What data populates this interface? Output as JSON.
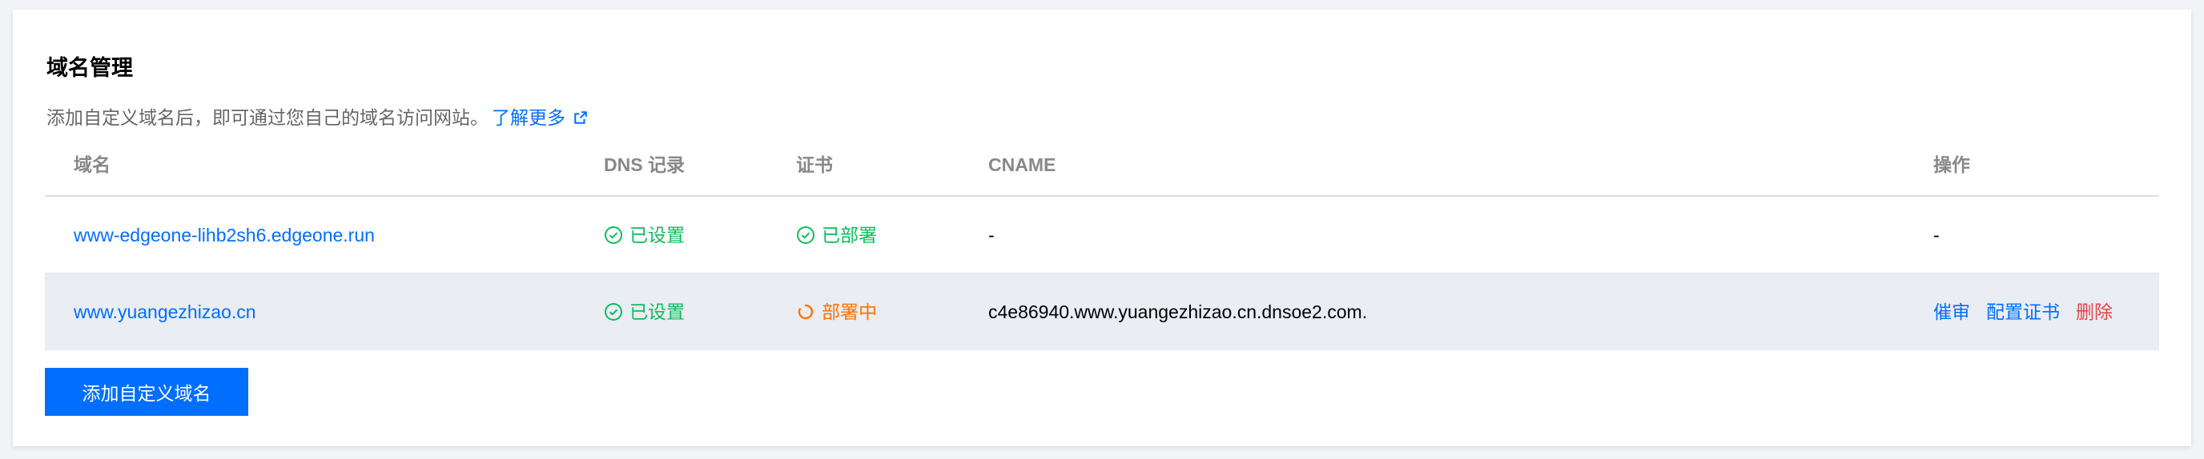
{
  "section": {
    "title": "域名管理",
    "description": "添加自定义域名后，即可通过您自己的域名访问网站。",
    "learn_more": "了解更多"
  },
  "table": {
    "columns": [
      "域名",
      "DNS 记录",
      "证书",
      "CNAME",
      "操作"
    ],
    "rows": [
      {
        "domain": "www-edgeone-lihb2sh6.edgeone.run",
        "dns": "已设置",
        "dns_status": "ok",
        "cert": "已部署",
        "cert_status": "ok",
        "cname": "-",
        "ops_text": "-"
      },
      {
        "domain": "www.yuangezhizao.cn",
        "dns": "已设置",
        "dns_status": "ok",
        "cert": "部署中",
        "cert_status": "pending",
        "cname": "c4e86940.www.yuangezhizao.cn.dnsoe2.com.",
        "ops": [
          "催审",
          "配置证书",
          "删除"
        ]
      }
    ]
  },
  "add_button": "添加自定义域名",
  "colors": {
    "link": "#006eff",
    "success": "#0abf5b",
    "pending": "#ff7200",
    "danger": "#e54545",
    "highlight_row": "#eaedf3"
  },
  "icons": {
    "external": "external-link-icon",
    "check": "check-circle-icon",
    "loading": "loading-spinner-icon"
  }
}
